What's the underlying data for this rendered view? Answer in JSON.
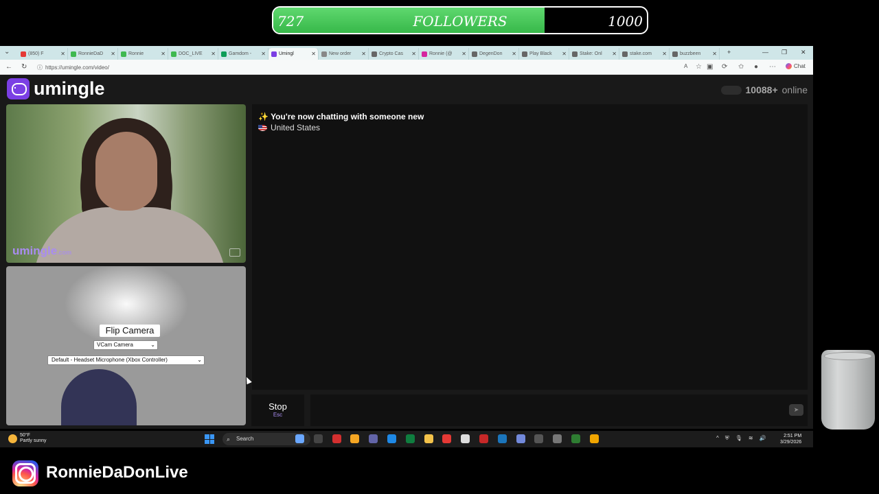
{
  "overlay": {
    "followers_current": "727",
    "followers_label": "FOLLOWERS",
    "followers_goal": "1000",
    "progress_fraction": 0.727,
    "instagram_handle": "RonnieDaDonLive"
  },
  "browser": {
    "tabs": [
      {
        "label": "(850) F",
        "color": "#e53935"
      },
      {
        "label": "RonnieDaD",
        "color": "#3fb950"
      },
      {
        "label": "Ronnie",
        "color": "#3fb950"
      },
      {
        "label": "DOC_LIVE",
        "color": "#3fb950"
      },
      {
        "label": "Gamdom -",
        "color": "#0f9d58"
      },
      {
        "label": "Umingl",
        "color": "#7b3fe4"
      },
      {
        "label": "New order",
        "color": "#888"
      },
      {
        "label": "Crypto Cas",
        "color": "#666"
      },
      {
        "label": "Ronnie (@",
        "color": "#d6249f"
      },
      {
        "label": "DegenDon",
        "color": "#666"
      },
      {
        "label": "Play Black",
        "color": "#666"
      },
      {
        "label": "Stake: Onl",
        "color": "#666"
      },
      {
        "label": "stake.com",
        "color": "#666"
      },
      {
        "label": "buzzbeen",
        "color": "#666"
      }
    ],
    "active_tab_index": 5,
    "url": "https://umingle.com/video/",
    "copilot_label": "Chat"
  },
  "page": {
    "logo_text": "umingle",
    "online_count": "10088+",
    "online_label": "online",
    "watermark": "umingle",
    "watermark_suffix": ".com",
    "chat_message": "You're now chatting with someone new",
    "chat_country": "United States",
    "flip_camera_label": "Flip Camera",
    "camera_select": "VCam Camera",
    "mic_select": "Default - Headset Microphone (Xbox Controller)",
    "stop_label": "Stop",
    "stop_key": "Esc"
  },
  "taskbar": {
    "weather_temp": "50°F",
    "weather_desc": "Partly sunny",
    "search_label": "Search",
    "time": "2:51 PM",
    "date": "3/29/2026"
  },
  "colors": {
    "brand_purple": "#7b3fe4",
    "progress_green": "#4cc95c"
  }
}
